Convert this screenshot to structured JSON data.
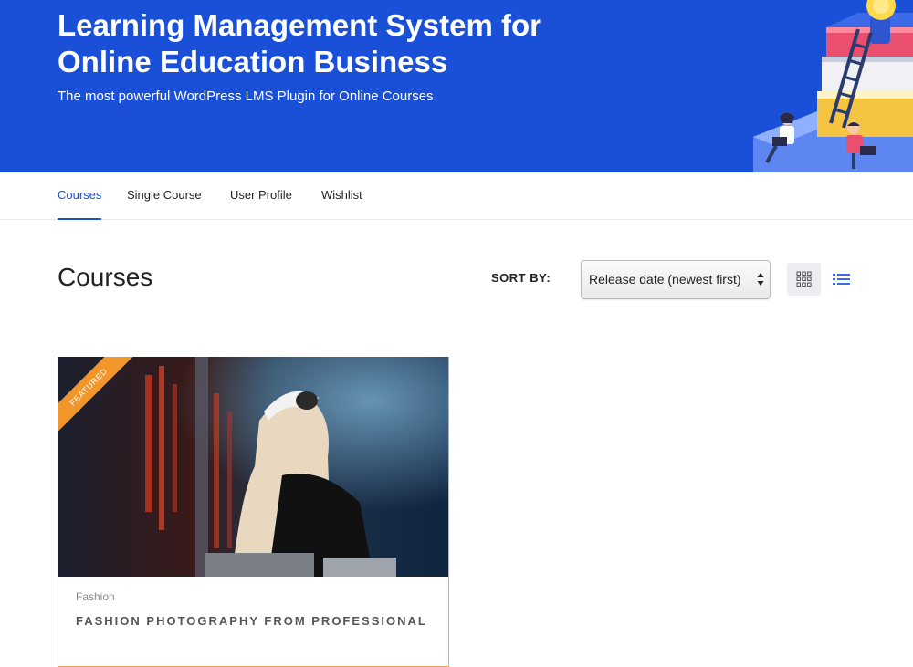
{
  "hero": {
    "title": "Learning Management System for Online Education Business",
    "subtitle": "The most powerful WordPress LMS Plugin for Online Courses",
    "illustration": "books-ladder-students-illustration"
  },
  "tabs": [
    {
      "label": "Courses",
      "active": true
    },
    {
      "label": "Single Course",
      "active": false
    },
    {
      "label": "User Profile",
      "active": false
    },
    {
      "label": "Wishlist",
      "active": false
    }
  ],
  "main": {
    "title": "Courses",
    "sort_label": "SORT BY:",
    "sort_selected": "Release date (newest first)",
    "views": [
      {
        "icon": "grid-view-icon",
        "active": true
      },
      {
        "icon": "list-view-icon",
        "active": false
      }
    ]
  },
  "courses": [
    {
      "badge": "FEATURED",
      "category": "Fashion",
      "title": "FASHION PHOTOGRAPHY FROM PROFESSIONAL",
      "image": "dj-with-headphones-photo"
    }
  ],
  "colors": {
    "brand_blue": "#1a50d8",
    "badge_orange": "#f2962a",
    "card_border": "#f0a860"
  }
}
